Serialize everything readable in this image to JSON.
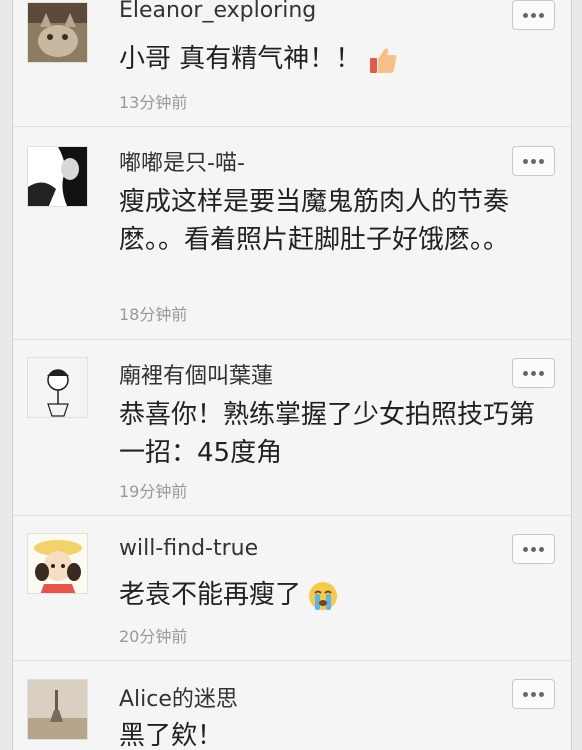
{
  "comments": [
    {
      "name": "Eleanor_exploring",
      "text": "小哥 真有精气神！！",
      "time": "13分钟前",
      "emoji": "thumbs-up"
    },
    {
      "name": "嘟嘟是只-喵-",
      "text": "瘦成这样是要当魔鬼筋肉人的节奏麽。。看着照片赶脚肚子好饿麽。。",
      "time": "18分钟前"
    },
    {
      "name": "廟裡有個叫葉蓮",
      "text": "恭喜你！熟练掌握了少女拍照技巧第一招：45度角",
      "time": "19分钟前"
    },
    {
      "name": "will-find-true",
      "text": "老袁不能再瘦了",
      "time": "20分钟前",
      "emoji": "crying-face"
    },
    {
      "name": "Alice的迷思",
      "text": "黑了欸！",
      "time": ""
    }
  ],
  "colors": {
    "background": "#f5f5f5",
    "text": "#222222",
    "muted": "#999999",
    "divider": "#dedede"
  }
}
